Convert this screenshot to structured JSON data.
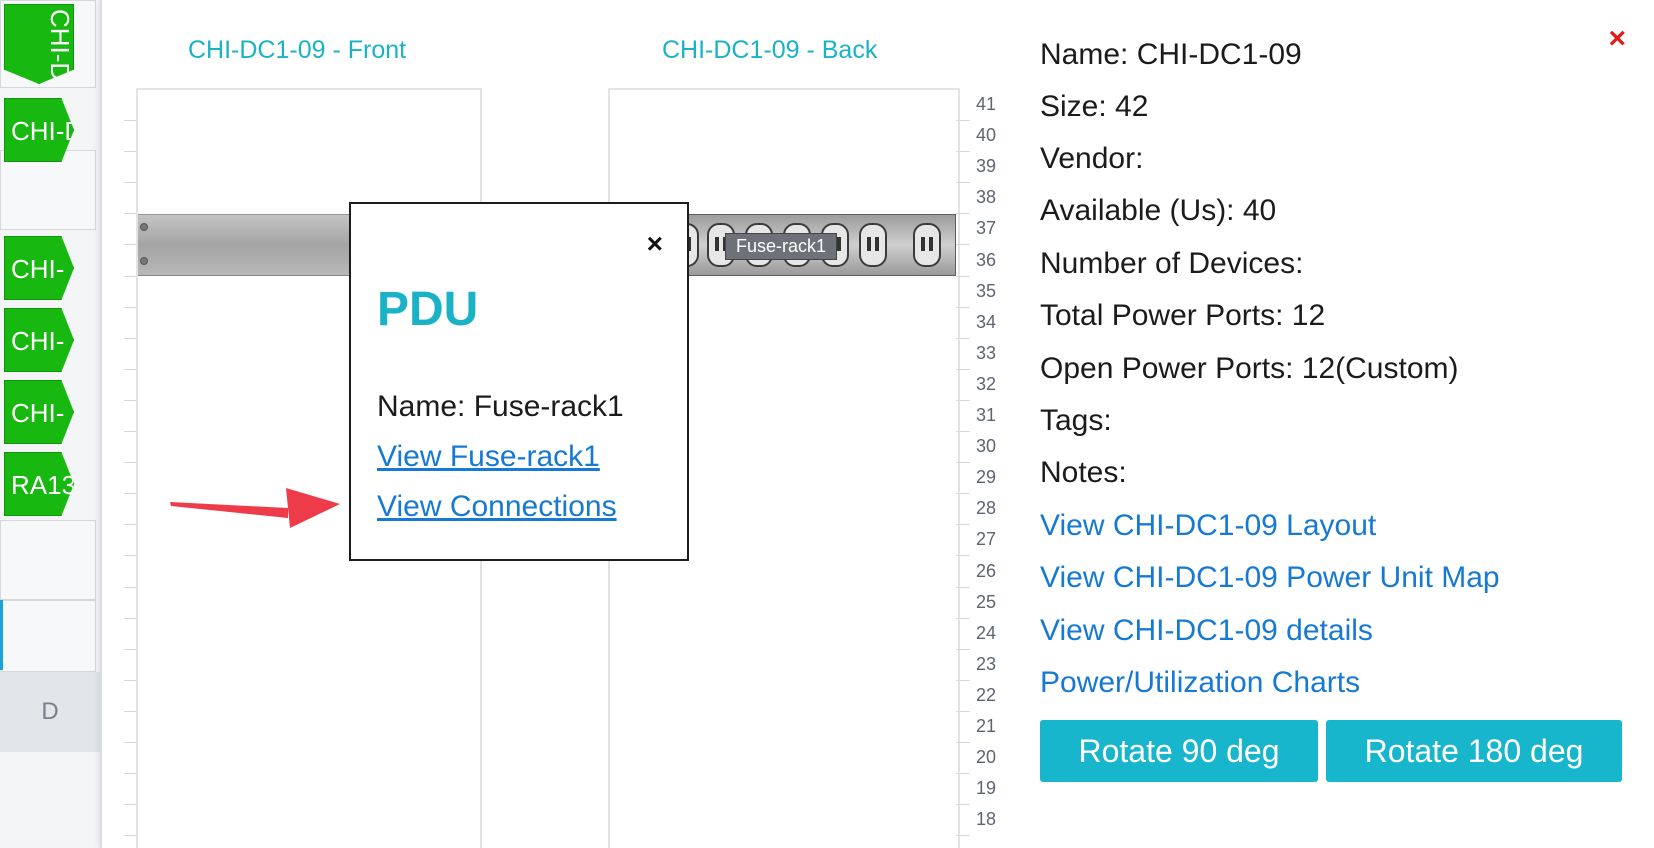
{
  "left_strip": {
    "rack_tags": [
      "CHI-D",
      "CHI-D",
      "CHI-",
      "CHI-",
      "CHI-",
      "RA13"
    ],
    "footer_label": "D"
  },
  "modal": {
    "close_glyph": "×",
    "front_title": "CHI-DC1-09 - Front",
    "back_title": "CHI-DC1-09 - Back",
    "u_numbers": [
      "41",
      "40",
      "39",
      "38",
      "37",
      "36",
      "35",
      "34",
      "33",
      "32",
      "31",
      "30",
      "29",
      "28",
      "27",
      "26",
      "25",
      "24",
      "23",
      "22",
      "21",
      "20",
      "19",
      "18"
    ],
    "device_label": "Fuse-rack1"
  },
  "popover": {
    "close_glyph": "×",
    "title": "PDU",
    "name": "Name: Fuse-rack1",
    "link_view_device": "View Fuse-rack1",
    "link_view_connections": "View Connections"
  },
  "info": {
    "name": "Name: CHI-DC1-09",
    "size": "Size: 42",
    "vendor": "Vendor:",
    "available": "Available (Us): 40",
    "num_devices": "Number of Devices:",
    "total_power_ports": "Total Power Ports: 12",
    "open_power_ports": "Open Power Ports: 12(Custom)",
    "tags": "Tags:",
    "notes": "Notes:",
    "link_layout": "View CHI-DC1-09 Layout",
    "link_power_map": "View CHI-DC1-09 Power Unit Map",
    "link_details": "View CHI-DC1-09 details",
    "link_charts": "Power/Utilization Charts",
    "btn_rotate_90": "Rotate 90 deg",
    "btn_rotate_180": "Rotate 180 deg"
  },
  "colors": {
    "accent_teal": "#1ab2c6",
    "link_blue": "#1679d4",
    "rack_tag_green": "#17b80f",
    "close_red": "#e01b1b",
    "arrow_red": "#ee3b4a"
  }
}
